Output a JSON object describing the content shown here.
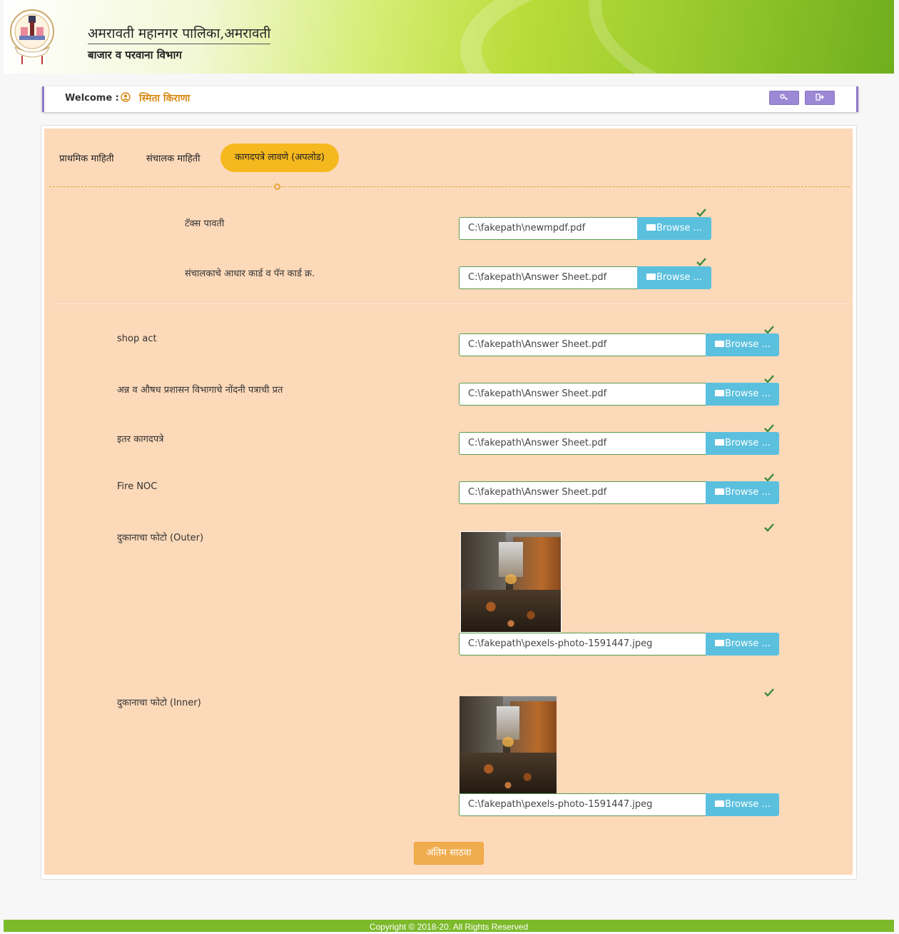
{
  "header": {
    "org_title": "अमरावती महानगर पालिका,अमरावती",
    "dept_title": "बाजार व परवाना विभाग"
  },
  "welcome": {
    "label": "Welcome :",
    "user_name": "स्मिता किराणा",
    "icons": [
      "key-icon",
      "logout-icon"
    ]
  },
  "tabs": [
    {
      "label": "प्राथमिक माहिती",
      "active": false
    },
    {
      "label": "संचालक माहिती",
      "active": false
    },
    {
      "label": "कागदपत्रे लावणे (अपलोड)",
      "active": true
    }
  ],
  "browse_label": "Browse ...",
  "documents": [
    {
      "label": "टॅक्स पावती",
      "value": "C:\\fakepath\\newmpdf.pdf",
      "uploaded": true
    },
    {
      "label": "संचालकाचे आधार कार्ड व पॅन कार्ड क्र.",
      "value": "C:\\fakepath\\Answer Sheet.pdf",
      "uploaded": true
    },
    {
      "label": "shop act",
      "value": "C:\\fakepath\\Answer Sheet.pdf",
      "uploaded": true
    },
    {
      "label": "अन्न व औषध प्रशासन विभागाचे नोंदनी पत्राची प्रत",
      "value": "C:\\fakepath\\Answer Sheet.pdf",
      "uploaded": true
    },
    {
      "label": "इतर कागदपत्रे",
      "value": "C:\\fakepath\\Answer Sheet.pdf",
      "uploaded": true
    },
    {
      "label": "Fire NOC",
      "value": "C:\\fakepath\\Answer Sheet.pdf",
      "uploaded": true
    },
    {
      "label": "दुकानाचा फोटो (Outer)",
      "value": "C:\\fakepath\\pexels-photo-1591447.jpeg",
      "uploaded": true
    },
    {
      "label": "दुकानाचा फोटो (Inner)",
      "value": "C:\\fakepath\\pexels-photo-1591447.jpeg",
      "uploaded": true
    }
  ],
  "submit_label": "अंतिम साठवा",
  "footer": "Copyright © 2018-20. All Rights Reserved",
  "colors": {
    "panel_bg": "#fcd9b9",
    "active_tab": "#f5b81e",
    "browse": "#5bc0de",
    "submit": "#f0ad4e",
    "footer": "#7cba2b",
    "user_name": "#d98a17"
  }
}
